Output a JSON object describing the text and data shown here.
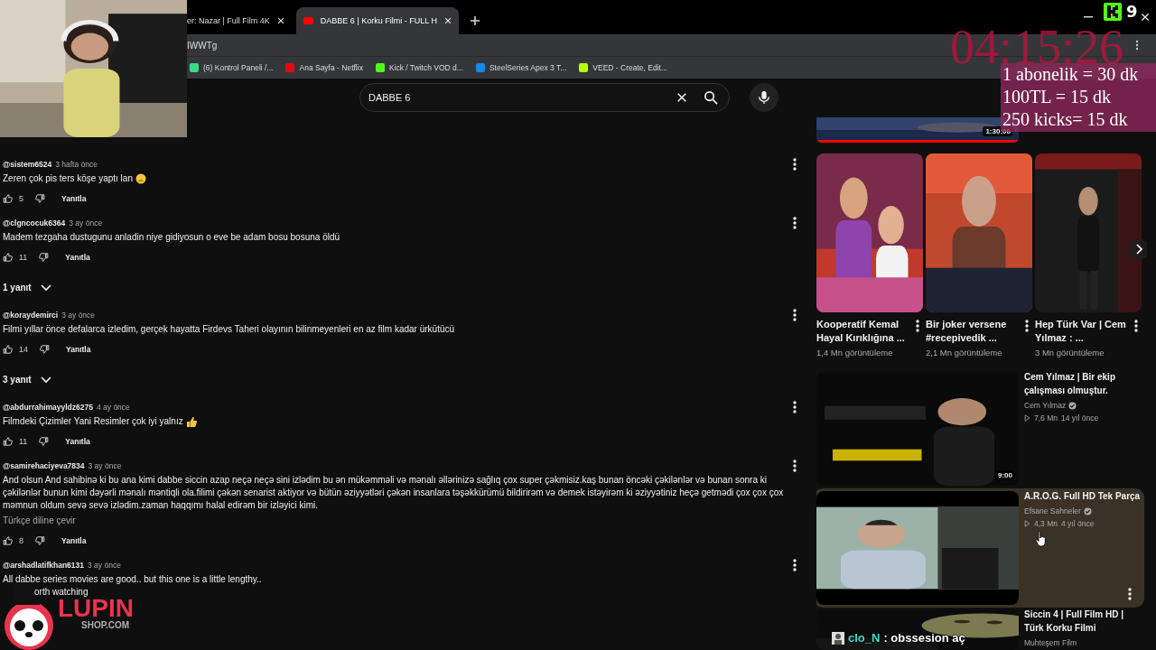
{
  "browser": {
    "tabs": [
      {
        "title": "er: Nazar | Full Film 4K",
        "selected": false
      },
      {
        "title": "DABBE 6 | Korku Filmi - FULL H",
        "selected": true
      }
    ],
    "address": "IWWTg",
    "bookmarks": [
      {
        "label": "(6) Kontrol Paneli /...",
        "color": "#3ddc84"
      },
      {
        "label": "Ana Sayfa - Netflix",
        "color": "#e50914"
      },
      {
        "label": "Kick / Twitch VOD d...",
        "color": "#53fc18"
      },
      {
        "label": "SteelSeries Apex 3 T...",
        "color": "#1e88e5"
      },
      {
        "label": "VEED - Create, Edit...",
        "color": "#b6ff00"
      }
    ]
  },
  "search": {
    "value": "DABBE 6"
  },
  "comments": [
    {
      "author": "@sistem6524",
      "time": "3 hafta önce",
      "text": "Zeren çok pis ters köşe yaptı lan",
      "kind": "sad",
      "likes": "5",
      "reply": "Yanıtla"
    },
    {
      "author": "@clgncocuk6364",
      "time": "3 ay önce",
      "text": "Madem tezgaha dustugunu anladin niye gidiyosun o eve be adam bosu bosuna öldü",
      "likes": "11",
      "reply": "Yanıtla",
      "replies": "1 yanıt"
    },
    {
      "author": "@koraydemirci",
      "time": "3 ay önce",
      "text": "Filmi yıllar önce defalarca izledim, gerçek hayatta Firdevs Taheri olayının bilinmeyenleri en az film kadar ürkütücü",
      "likes": "14",
      "reply": "Yanıtla",
      "replies": "3 yanıt"
    },
    {
      "author": "@abdurrahimayyldz6275",
      "time": "4 ay önce",
      "text": "Filmdeki Çizimler Yani Resimler çok iyi yalnız",
      "kind": "thumbs",
      "likes": "11",
      "reply": "Yanıtla"
    },
    {
      "author": "@samirehaciyeva7834",
      "time": "3 ay önce",
      "text": "And olsun And sahibinə ki bu ana kimi dabbe siccin azap neçə neçə sini izlədim bu ən mükəmməli və mənalı əllərinizə sağlıq çox super çəkmisiz.kaş bunan öncəki çəkilənlər və bunan sonra ki çəkilənlər bunun kimi dəyərli mənalı məntiqli ola.filimi çəkən senarist aktiyor və bütün əziyyətləri çəkən insanlara təşəkkürümü bildirirəm və demek istəyirəm ki əziyyətiniz heçə getmədi çox çox çox məmnun oldum sevə sevə izlədim.zaman haqqımı halal edirəm bir izləyici kimi.",
      "translate": "Türkçe diline çevir",
      "likes": "8",
      "reply": "Yanıtla"
    },
    {
      "author": "@arshadlatifkhan6131",
      "time": "3 ay önce",
      "text": "All dabbe series movies are good.. but this one is a little lengthy..",
      "tail": "orth watching"
    }
  ],
  "sidebar": {
    "top_video": {
      "duration": "1:30:06",
      "level": 1
    },
    "shorts": [
      {
        "title": "Kooperatif Kemal Hayal Kırıklığına ...",
        "views": "1,4 Mn görüntüleme"
      },
      {
        "title": "Bir joker versene #recepivedik ...",
        "views": "2,1 Mn görüntüleme"
      },
      {
        "title": "Hep Türk Var | Cem Yılmaz : ...",
        "views": "3 Mn görüntüleme"
      }
    ],
    "videos": [
      {
        "title": "Cem Yılmaz | Bir ekip çalışması olmuştur.",
        "channel": "Cem Yılmaz",
        "verified": true,
        "views": "7,6 Mn",
        "age": "14 yıl önce",
        "duration": "9:00",
        "hovered": false
      },
      {
        "title": "A.R.O.G. Full HD Tek Parça",
        "channel": "Efsane Sahneler",
        "verified": true,
        "views": "4,3 Mn",
        "age": "4 yıl önce",
        "hovered": true
      },
      {
        "title": "Siccin 4 | Full Film HD | Türk Korku Filmi",
        "channel": "Muhteşem Film",
        "verified": false,
        "hovered": false
      }
    ]
  },
  "overlay": {
    "timer": "04:15:26",
    "promo": [
      "1 abonelik = 30 dk",
      "100TL = 15 dk",
      "250 kicks= 15 dk"
    ],
    "kick_count": "9",
    "chat": {
      "user": "clo_N",
      "message": ": obssesion aç"
    },
    "logo": {
      "name": "LUPIN",
      "sub": "SHOP.COM"
    }
  }
}
